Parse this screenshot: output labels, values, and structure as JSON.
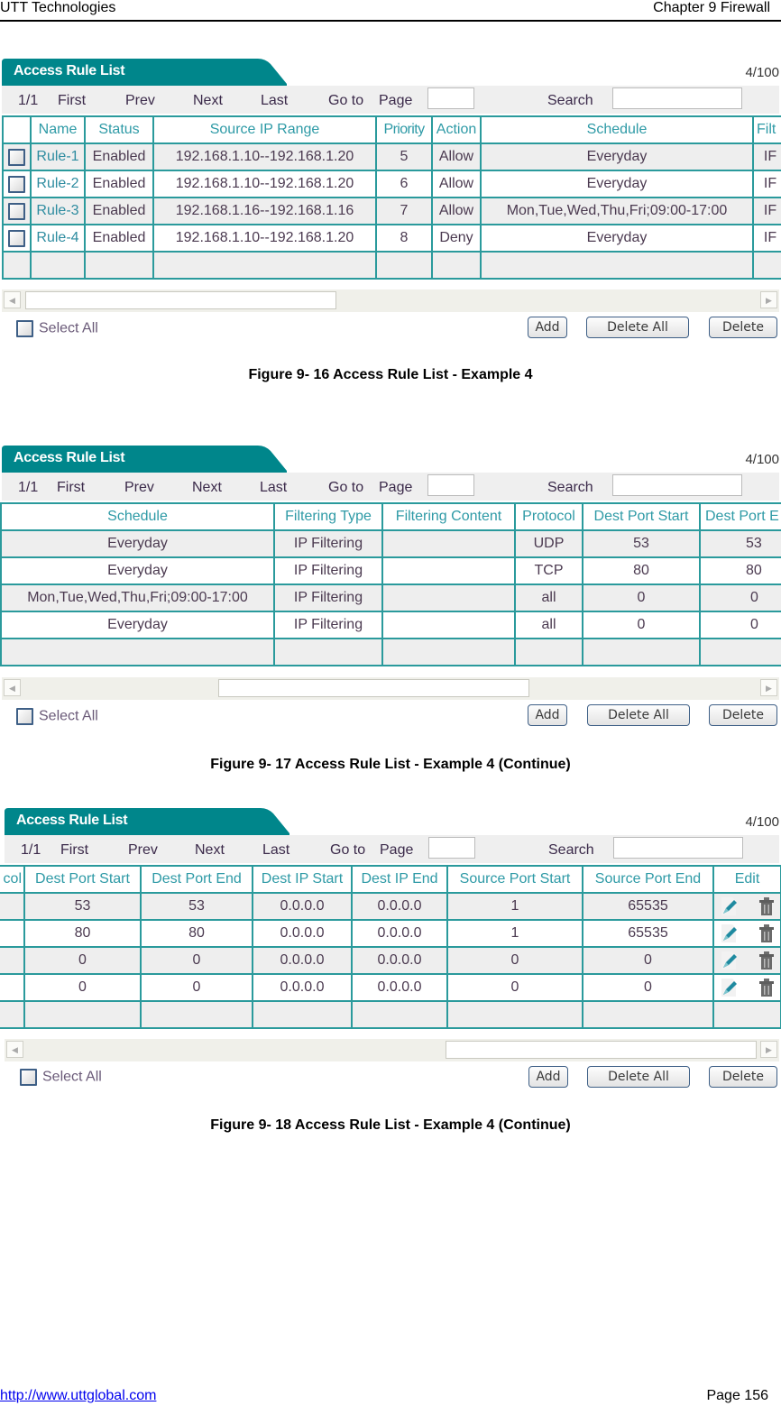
{
  "header": {
    "left": "UTT Technologies",
    "right": "Chapter 9 Firewall"
  },
  "footer": {
    "link": "http://www.uttglobal.com",
    "page": "Page 156"
  },
  "colors": {
    "accent": "#00868b",
    "grid": "#2a9a9c",
    "header_text": "#2e9aa6"
  },
  "panel": {
    "title": "Access Rule List",
    "count": "4/100",
    "pager": {
      "page": "1/1",
      "first": "First",
      "prev": "Prev",
      "next": "Next",
      "last": "Last",
      "goto": "Go to",
      "page_label": "Page",
      "search": "Search",
      "page_value": "",
      "search_value": ""
    },
    "select_all": "Select All",
    "buttons": {
      "add": "Add",
      "delete_all": "Delete All",
      "delete": "Delete"
    }
  },
  "figures": [
    {
      "caption": "Figure 9- 16 Access Rule List - Example 4",
      "columns": [
        "",
        "Name",
        "Status",
        "Source IP Range",
        "Priority",
        "Action",
        "Schedule",
        "Filt"
      ],
      "rows": [
        [
          "",
          "Rule-1",
          "Enabled",
          "192.168.1.10--192.168.1.20",
          "5",
          "Allow",
          "Everyday",
          "IF"
        ],
        [
          "",
          "Rule-2",
          "Enabled",
          "192.168.1.10--192.168.1.20",
          "6",
          "Allow",
          "Everyday",
          "IF"
        ],
        [
          "",
          "Rule-3",
          "Enabled",
          "192.168.1.16--192.168.1.16",
          "7",
          "Allow",
          "Mon,Tue,Wed,Thu,Fri;09:00-17:00",
          "IF"
        ],
        [
          "",
          "Rule-4",
          "Enabled",
          "192.168.1.10--192.168.1.20",
          "8",
          "Deny",
          "Everyday",
          "IF"
        ]
      ]
    },
    {
      "caption": "Figure 9- 17 Access Rule List - Example 4 (Continue)",
      "columns": [
        "Schedule",
        "Filtering Type",
        "Filtering Content",
        "Protocol",
        "Dest Port Start",
        "Dest Port E"
      ],
      "rows": [
        [
          "Everyday",
          "IP Filtering",
          "",
          "UDP",
          "53",
          "53"
        ],
        [
          "Everyday",
          "IP Filtering",
          "",
          "TCP",
          "80",
          "80"
        ],
        [
          "Mon,Tue,Wed,Thu,Fri;09:00-17:00",
          "IP Filtering",
          "",
          "all",
          "0",
          "0"
        ],
        [
          "Everyday",
          "IP Filtering",
          "",
          "all",
          "0",
          "0"
        ]
      ]
    },
    {
      "caption": "Figure 9- 18 Access Rule List - Example 4 (Continue)",
      "columns": [
        "col",
        "Dest Port Start",
        "Dest Port End",
        "Dest IP Start",
        "Dest IP End",
        "Source Port Start",
        "Source Port End",
        "Edit"
      ],
      "rows": [
        [
          "",
          "53",
          "53",
          "0.0.0.0",
          "0.0.0.0",
          "1",
          "65535",
          ""
        ],
        [
          "",
          "80",
          "80",
          "0.0.0.0",
          "0.0.0.0",
          "1",
          "65535",
          ""
        ],
        [
          "",
          "0",
          "0",
          "0.0.0.0",
          "0.0.0.0",
          "0",
          "0",
          ""
        ],
        [
          "",
          "0",
          "0",
          "0.0.0.0",
          "0.0.0.0",
          "0",
          "0",
          ""
        ]
      ]
    }
  ]
}
